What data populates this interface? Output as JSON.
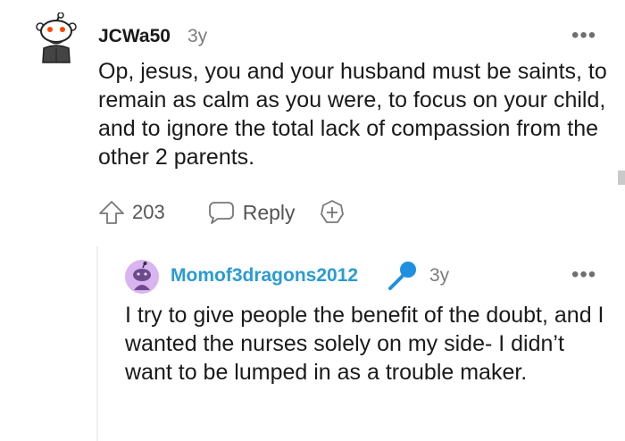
{
  "top_comment": {
    "username": "JCWa50",
    "age": "3y",
    "more_label": "•••",
    "avatar_icon": "snoo-bearded-avatar-icon",
    "body": "Op, jesus, you and your husband must be saints, to remain as calm as you were, to focus on your child, and to ignore the total lack of compassion from the other 2 parents.",
    "vote_count": "203",
    "reply_label": "Reply",
    "upvote_icon": "upvote-arrow-icon",
    "reply_icon": "speech-bubble-icon",
    "award_icon": "award-plus-icon"
  },
  "reply_comment": {
    "username": "Momof3dragons2012",
    "age": "3y",
    "more_label": "•••",
    "avatar_icon": "snoo-purple-avatar-icon",
    "flair_icon": "microphone-icon",
    "body": "I try to give people the benefit of the doubt, and I wanted the nurses solely on my side- I didn’t want to be lumped in as a trouble maker."
  },
  "colors": {
    "username_reply": "#2a9bd4",
    "meta_gray": "#7c7c7c",
    "text": "#1a1a1b",
    "avatar_purple": "#d8b4f0",
    "mic_blue": "#1f8fe0"
  }
}
